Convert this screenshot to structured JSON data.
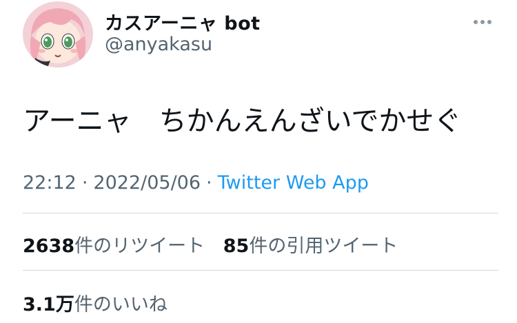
{
  "author": {
    "display_name": "カスアーニャ bot",
    "handle": "@anyakasu"
  },
  "tweet": {
    "text": "アーニャ　ちかんえんざいでかせぐ",
    "time": "22:12",
    "date": "2022/05/06",
    "separator": "·",
    "source": "Twitter Web App"
  },
  "stats": {
    "retweets": {
      "count": "2638",
      "label": "件のリツイート"
    },
    "quotes": {
      "count": "85",
      "label": "件の引用ツイート"
    },
    "likes": {
      "count": "3.1万",
      "label": "件のいいね"
    }
  },
  "icons": {
    "more": "more-horizontal-icon",
    "avatar": "anime-avatar"
  },
  "colors": {
    "link": "#1d9bf0",
    "secondary_text": "#536471",
    "primary_text": "#0f1419",
    "divider": "#cfd9de"
  }
}
